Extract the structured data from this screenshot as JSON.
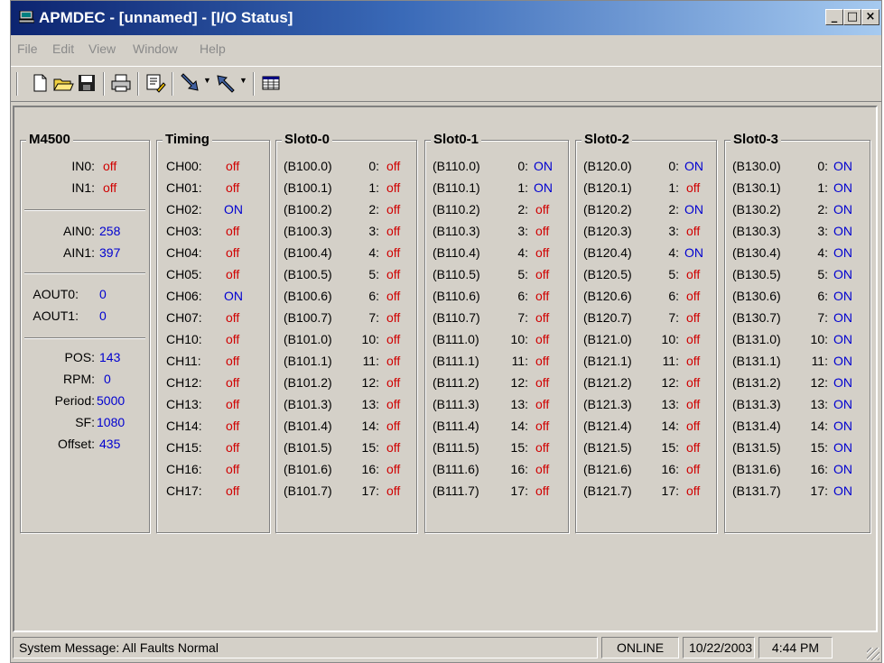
{
  "window": {
    "title": "APMDEC - [unnamed] - [I/O Status]",
    "controls": {
      "minimize": "_",
      "maximize": "□",
      "close": "×"
    }
  },
  "menu": [
    "File",
    "Edit",
    "View",
    "Window",
    "Help"
  ],
  "toolbar": {
    "icons": [
      "new-file-icon",
      "open-folder-icon",
      "save-disk-icon",
      "print-icon",
      "edit-notes-icon",
      "download-arrow-icon",
      "upload-arrow-icon",
      "table-grid-icon"
    ]
  },
  "m4500": {
    "title": "M4500",
    "inputs": [
      {
        "label": "IN0:",
        "value": "off"
      },
      {
        "label": "IN1:",
        "value": "off"
      }
    ],
    "analog_in": [
      {
        "label": "AIN0:",
        "value": "258"
      },
      {
        "label": "AIN1:",
        "value": "397"
      }
    ],
    "analog_out": [
      {
        "label": "AOUT0:",
        "value": "0"
      },
      {
        "label": "AOUT1:",
        "value": "0"
      }
    ],
    "motion": [
      {
        "label": "POS:",
        "value": "143"
      },
      {
        "label": "RPM:",
        "value": "0"
      },
      {
        "label": "Period:",
        "value": "5000"
      },
      {
        "label": "SF:",
        "value": "1080"
      },
      {
        "label": "Offset:",
        "value": "435"
      }
    ]
  },
  "timing": {
    "title": "Timing",
    "channels": [
      {
        "label": "CH00:",
        "value": "off"
      },
      {
        "label": "CH01:",
        "value": "off"
      },
      {
        "label": "CH02:",
        "value": "ON"
      },
      {
        "label": "CH03:",
        "value": "off"
      },
      {
        "label": "CH04:",
        "value": "off"
      },
      {
        "label": "CH05:",
        "value": "off"
      },
      {
        "label": "CH06:",
        "value": "ON"
      },
      {
        "label": "CH07:",
        "value": "off"
      },
      {
        "label": "CH10:",
        "value": "off"
      },
      {
        "label": "CH11:",
        "value": "off"
      },
      {
        "label": "CH12:",
        "value": "off"
      },
      {
        "label": "CH13:",
        "value": "off"
      },
      {
        "label": "CH14:",
        "value": "off"
      },
      {
        "label": "CH15:",
        "value": "off"
      },
      {
        "label": "CH16:",
        "value": "off"
      },
      {
        "label": "CH17:",
        "value": "off"
      }
    ]
  },
  "slots": [
    {
      "title": "Slot0-0",
      "rows": [
        {
          "addr": "(B100.0)",
          "num": "0:",
          "value": "off"
        },
        {
          "addr": "(B100.1)",
          "num": "1:",
          "value": "off"
        },
        {
          "addr": "(B100.2)",
          "num": "2:",
          "value": "off"
        },
        {
          "addr": "(B100.3)",
          "num": "3:",
          "value": "off"
        },
        {
          "addr": "(B100.4)",
          "num": "4:",
          "value": "off"
        },
        {
          "addr": "(B100.5)",
          "num": "5:",
          "value": "off"
        },
        {
          "addr": "(B100.6)",
          "num": "6:",
          "value": "off"
        },
        {
          "addr": "(B100.7)",
          "num": "7:",
          "value": "off"
        },
        {
          "addr": "(B101.0)",
          "num": "10:",
          "value": "off"
        },
        {
          "addr": "(B101.1)",
          "num": "11:",
          "value": "off"
        },
        {
          "addr": "(B101.2)",
          "num": "12:",
          "value": "off"
        },
        {
          "addr": "(B101.3)",
          "num": "13:",
          "value": "off"
        },
        {
          "addr": "(B101.4)",
          "num": "14:",
          "value": "off"
        },
        {
          "addr": "(B101.5)",
          "num": "15:",
          "value": "off"
        },
        {
          "addr": "(B101.6)",
          "num": "16:",
          "value": "off"
        },
        {
          "addr": "(B101.7)",
          "num": "17:",
          "value": "off"
        }
      ]
    },
    {
      "title": "Slot0-1",
      "rows": [
        {
          "addr": "(B110.0)",
          "num": "0:",
          "value": "ON"
        },
        {
          "addr": "(B110.1)",
          "num": "1:",
          "value": "ON"
        },
        {
          "addr": "(B110.2)",
          "num": "2:",
          "value": "off"
        },
        {
          "addr": "(B110.3)",
          "num": "3:",
          "value": "off"
        },
        {
          "addr": "(B110.4)",
          "num": "4:",
          "value": "off"
        },
        {
          "addr": "(B110.5)",
          "num": "5:",
          "value": "off"
        },
        {
          "addr": "(B110.6)",
          "num": "6:",
          "value": "off"
        },
        {
          "addr": "(B110.7)",
          "num": "7:",
          "value": "off"
        },
        {
          "addr": "(B111.0)",
          "num": "10:",
          "value": "off"
        },
        {
          "addr": "(B111.1)",
          "num": "11:",
          "value": "off"
        },
        {
          "addr": "(B111.2)",
          "num": "12:",
          "value": "off"
        },
        {
          "addr": "(B111.3)",
          "num": "13:",
          "value": "off"
        },
        {
          "addr": "(B111.4)",
          "num": "14:",
          "value": "off"
        },
        {
          "addr": "(B111.5)",
          "num": "15:",
          "value": "off"
        },
        {
          "addr": "(B111.6)",
          "num": "16:",
          "value": "off"
        },
        {
          "addr": "(B111.7)",
          "num": "17:",
          "value": "off"
        }
      ]
    },
    {
      "title": "Slot0-2",
      "rows": [
        {
          "addr": "(B120.0)",
          "num": "0:",
          "value": "ON"
        },
        {
          "addr": "(B120.1)",
          "num": "1:",
          "value": "off"
        },
        {
          "addr": "(B120.2)",
          "num": "2:",
          "value": "ON"
        },
        {
          "addr": "(B120.3)",
          "num": "3:",
          "value": "off"
        },
        {
          "addr": "(B120.4)",
          "num": "4:",
          "value": "ON"
        },
        {
          "addr": "(B120.5)",
          "num": "5:",
          "value": "off"
        },
        {
          "addr": "(B120.6)",
          "num": "6:",
          "value": "off"
        },
        {
          "addr": "(B120.7)",
          "num": "7:",
          "value": "off"
        },
        {
          "addr": "(B121.0)",
          "num": "10:",
          "value": "off"
        },
        {
          "addr": "(B121.1)",
          "num": "11:",
          "value": "off"
        },
        {
          "addr": "(B121.2)",
          "num": "12:",
          "value": "off"
        },
        {
          "addr": "(B121.3)",
          "num": "13:",
          "value": "off"
        },
        {
          "addr": "(B121.4)",
          "num": "14:",
          "value": "off"
        },
        {
          "addr": "(B121.5)",
          "num": "15:",
          "value": "off"
        },
        {
          "addr": "(B121.6)",
          "num": "16:",
          "value": "off"
        },
        {
          "addr": "(B121.7)",
          "num": "17:",
          "value": "off"
        }
      ]
    },
    {
      "title": "Slot0-3",
      "rows": [
        {
          "addr": "(B130.0)",
          "num": "0:",
          "value": "ON"
        },
        {
          "addr": "(B130.1)",
          "num": "1:",
          "value": "ON"
        },
        {
          "addr": "(B130.2)",
          "num": "2:",
          "value": "ON"
        },
        {
          "addr": "(B130.3)",
          "num": "3:",
          "value": "ON"
        },
        {
          "addr": "(B130.4)",
          "num": "4:",
          "value": "ON"
        },
        {
          "addr": "(B130.5)",
          "num": "5:",
          "value": "ON"
        },
        {
          "addr": "(B130.6)",
          "num": "6:",
          "value": "ON"
        },
        {
          "addr": "(B130.7)",
          "num": "7:",
          "value": "ON"
        },
        {
          "addr": "(B131.0)",
          "num": "10:",
          "value": "ON"
        },
        {
          "addr": "(B131.1)",
          "num": "11:",
          "value": "ON"
        },
        {
          "addr": "(B131.2)",
          "num": "12:",
          "value": "ON"
        },
        {
          "addr": "(B131.3)",
          "num": "13:",
          "value": "ON"
        },
        {
          "addr": "(B131.4)",
          "num": "14:",
          "value": "ON"
        },
        {
          "addr": "(B131.5)",
          "num": "15:",
          "value": "ON"
        },
        {
          "addr": "(B131.6)",
          "num": "16:",
          "value": "ON"
        },
        {
          "addr": "(B131.7)",
          "num": "17:",
          "value": "ON"
        }
      ]
    }
  ],
  "status": {
    "message": "System Message:  All Faults Normal",
    "connection": "ONLINE",
    "date": "10/22/2003",
    "time": "4:44 PM"
  },
  "colors": {
    "on": "#0000d0",
    "off": "#d00000",
    "titlebar_start": "#0c2470",
    "titlebar_end": "#a6caf0",
    "face": "#d4d0c8"
  }
}
